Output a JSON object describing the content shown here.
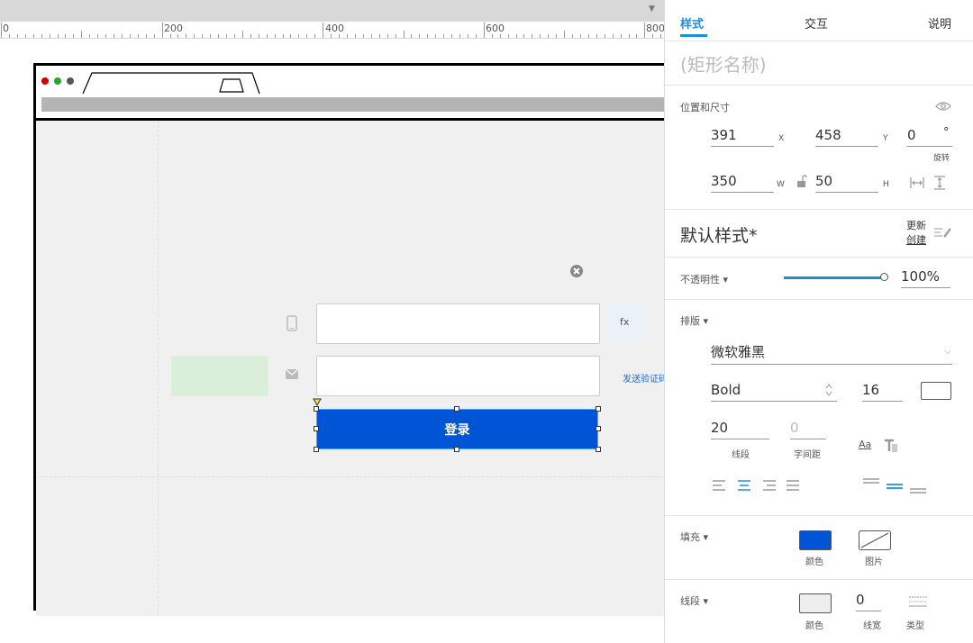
{
  "ruler": {
    "labels": [
      "0",
      "200",
      "400",
      "600",
      "800"
    ]
  },
  "form": {
    "fx_label": "fx",
    "send_code_label": "发送验证码",
    "login_label": "登录"
  },
  "panel": {
    "tabs": [
      "样式",
      "交互",
      "说明"
    ],
    "shape_name_placeholder": "(矩形名称)",
    "position_size": {
      "label": "位置和尺寸",
      "x": "391",
      "x_label": "X",
      "y": "458",
      "y_label": "Y",
      "rotation": "0",
      "rotation_unit": "°",
      "rotation_label": "旋转",
      "w": "350",
      "w_label": "W",
      "h": "50",
      "h_label": "H"
    },
    "style": {
      "name": "默认样式*",
      "update": "更新",
      "create": "创建"
    },
    "opacity": {
      "label": "不透明性 ▾",
      "value": "100%",
      "level": 1.0
    },
    "typography": {
      "label": "排版 ▾",
      "font_family": "微软雅黑",
      "font_weight": "Bold",
      "font_size": "16",
      "line_spacing": "20",
      "line_spacing_label": "线段",
      "letter_spacing": "0",
      "letter_spacing_label": "字间距",
      "aa": "Aa"
    },
    "fill": {
      "label": "填充 ▾",
      "color_label": "颜色",
      "image_label": "图片",
      "color": "#0055d6"
    },
    "border": {
      "label": "线段 ▾",
      "color_label": "颜色",
      "width": "0",
      "width_label": "线宽",
      "type_label": "类型"
    },
    "accent_color": "#1a8fe0"
  }
}
